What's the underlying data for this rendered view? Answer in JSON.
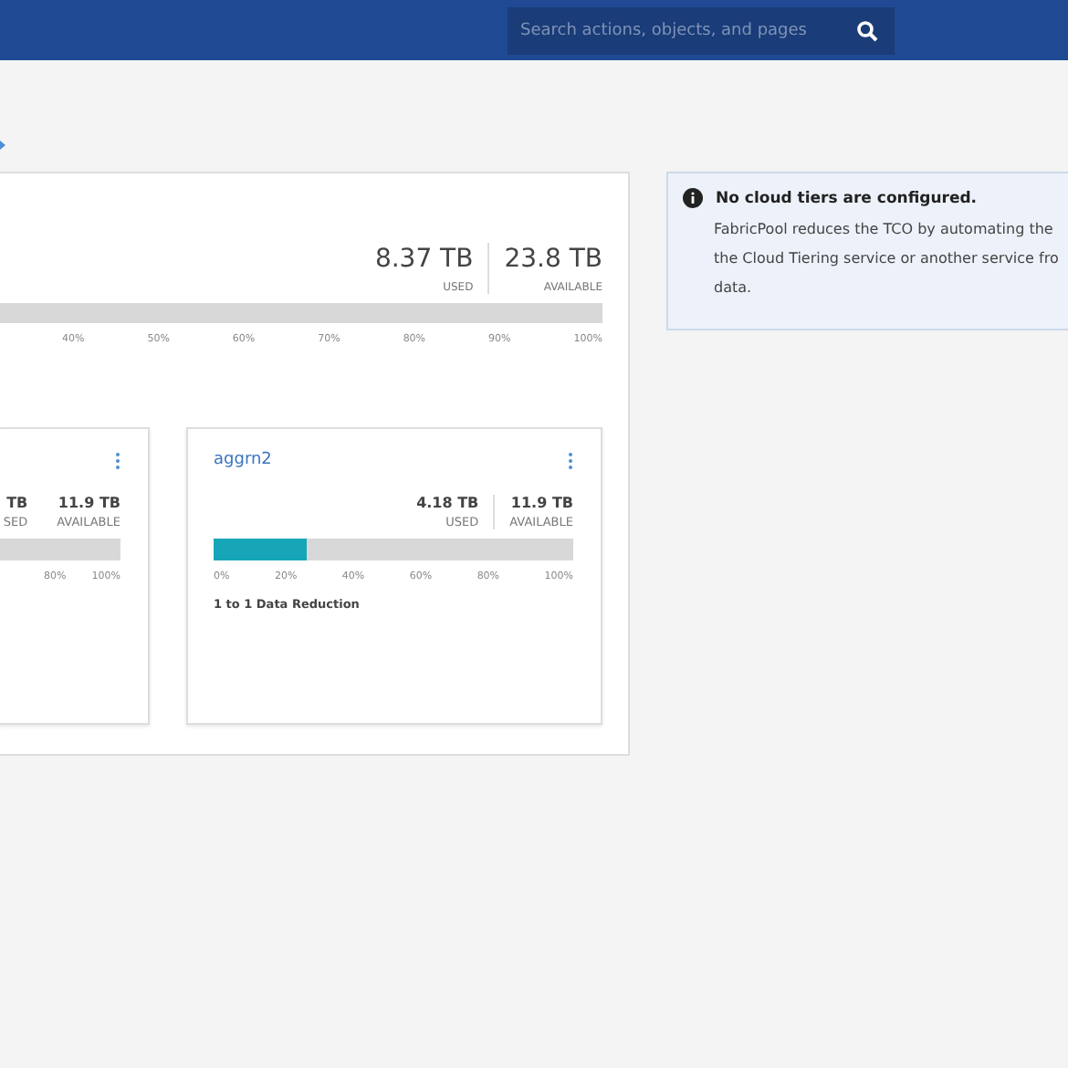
{
  "header": {
    "search": {
      "placeholder": "Search actions, objects, and pages"
    }
  },
  "capacity": {
    "used": "8.37 TB",
    "used_label": "USED",
    "available": "23.8 TB",
    "available_label": "AVAILABLE",
    "ticks": [
      "40%",
      "50%",
      "60%",
      "70%",
      "80%",
      "90%",
      "100%"
    ]
  },
  "aggregates": [
    {
      "kind": "partial",
      "used": "TB",
      "used_label": "SED",
      "available": "11.9 TB",
      "available_label": "AVAILABLE",
      "ticks": [
        "80%",
        "100%"
      ]
    },
    {
      "kind": "full",
      "name": "aggrn2",
      "used": "4.18 TB",
      "used_label": "USED",
      "available": "11.9 TB",
      "available_label": "AVAILABLE",
      "level": 0.26,
      "ticks": [
        "0%",
        "20%",
        "40%",
        "60%",
        "80%",
        "100%"
      ],
      "reduction": "1 to 1 Data Reduction"
    }
  ],
  "notice": {
    "title": "No cloud tiers are configured.",
    "lines": [
      "FabricPool reduces the TCO by automating the",
      "the Cloud Tiering service or another service fro",
      "data."
    ]
  }
}
